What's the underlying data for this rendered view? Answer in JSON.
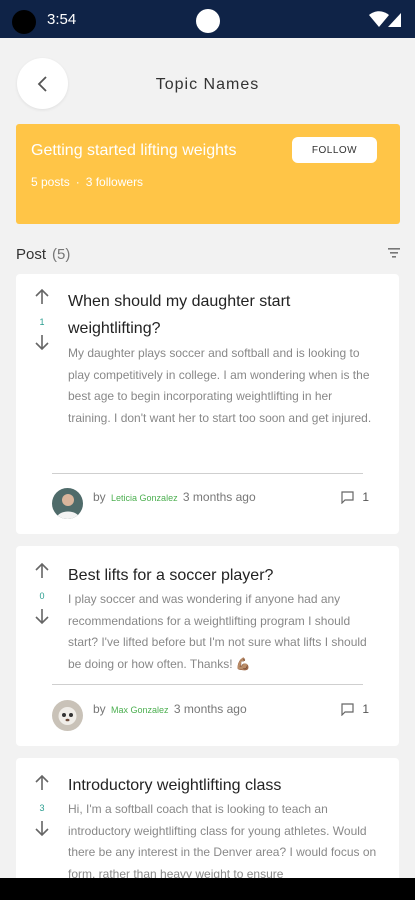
{
  "status_bar": {
    "time": "3:54"
  },
  "header": {
    "title": "Topic Names"
  },
  "topic": {
    "title": "Getting started lifting weights",
    "posts_count": "5 posts",
    "followers_count": "3 followers",
    "follow_label": "FOLLOW"
  },
  "posts_section": {
    "label": "Post",
    "count": "(5)"
  },
  "posts": [
    {
      "votes": "1",
      "title": "When should my daughter start weightlifting?",
      "body": "My daughter plays soccer and softball and is looking to play competitively in college. I am wondering when is the best age to begin incorporating weightlifting in her training. I don't want her to start too soon and get injured.",
      "by": "by",
      "author": "Leticia   Gonzalez",
      "time": "3 months ago",
      "comments": "1"
    },
    {
      "votes": "0",
      "title": "Best lifts for a soccer player?",
      "body": "I play soccer and was wondering if anyone had any recommendations for a weightlifting program I should start? I've lifted before but I'm not sure what lifts I should be doing or how often. Thanks! 💪🏽",
      "by": "by",
      "author": "Max Gonzalez",
      "time": "3 months ago",
      "comments": "1"
    },
    {
      "votes": "3",
      "title": "Introductory weightlifting class",
      "body": "Hi, I'm a softball coach that is looking to teach an introductory weightlifting class for young athletes. Would there be any interest in the Denver area? I would focus on form, rather than heavy weight to ensure"
    }
  ],
  "colors": {
    "banner": "#ffc547",
    "status_bar": "#0f2347",
    "author": "#4caf50",
    "votes": "#2a9d8f"
  }
}
